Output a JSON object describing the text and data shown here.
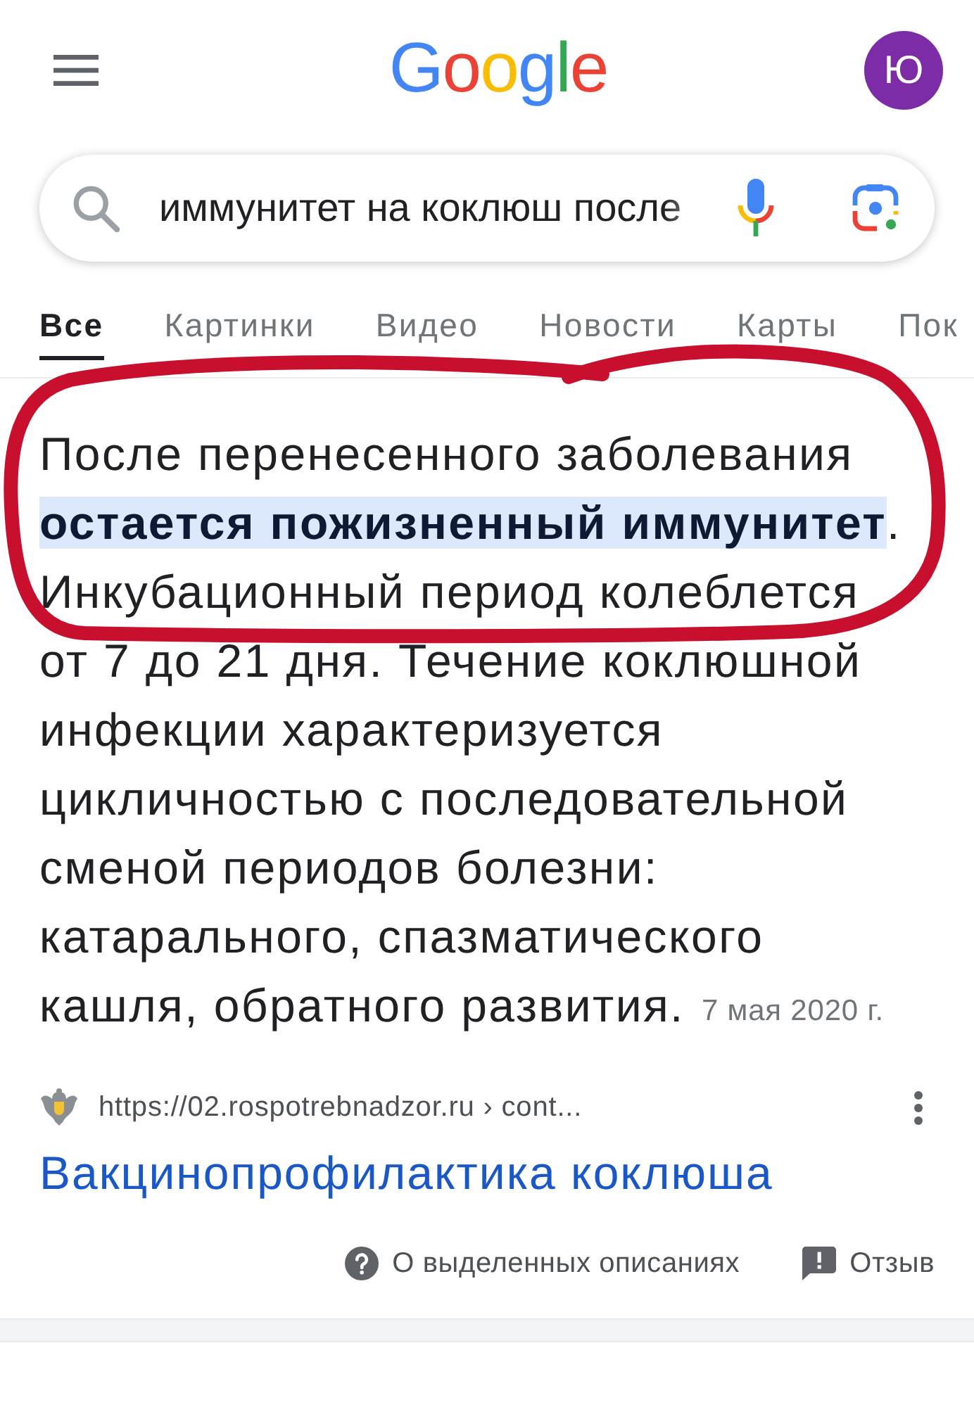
{
  "header": {
    "logo": "Google",
    "account_initial": "Ю"
  },
  "search": {
    "value": "иммунитет на коклюш после"
  },
  "tabs": [
    {
      "label": "Все",
      "selected": true
    },
    {
      "label": "Картинки",
      "selected": false
    },
    {
      "label": "Видео",
      "selected": false
    },
    {
      "label": "Новости",
      "selected": false
    },
    {
      "label": "Карты",
      "selected": false
    },
    {
      "label": "Пок",
      "selected": false
    }
  ],
  "featured_snippet": {
    "text": "После перенесенного заболевания **остается пожизненный иммунитет**. Инкубационный период колеблется от 7 до 21 дня. Течение коклюшной инфекции характеризуется цикличностью с последовательной сменой периодов болезни: катарального, спазматического кашля, обратного развития.",
    "date": "7 мая 2020 г.",
    "annotation": {
      "kind": "circle"
    }
  },
  "source": {
    "url": "https://02.rospotrebnadzor.ru › cont...",
    "title": "Вакцинопрофилактика коклюша"
  },
  "footer": {
    "about": "О выделенных описаниях",
    "feedback": "Отзыв"
  }
}
